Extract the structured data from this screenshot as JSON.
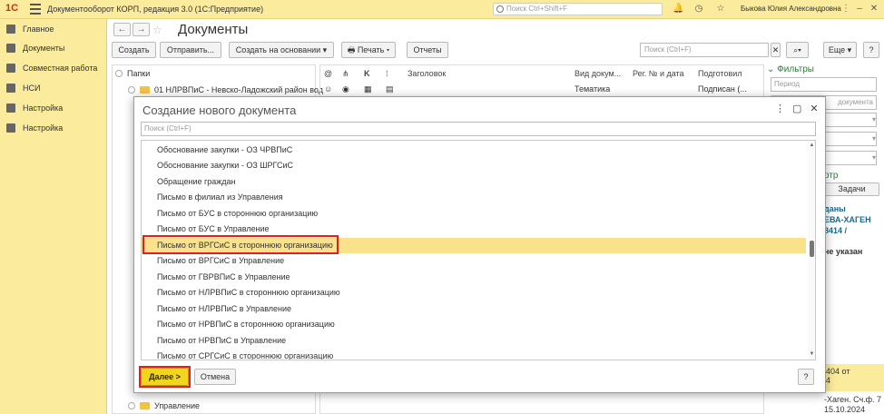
{
  "titlebar": {
    "app_title": "Документооборот КОРП, редакция 3.0  (1С:Предприятие)",
    "search_placeholder": "Поиск Ctrl+Shift+F",
    "user": "Быкова Юлия Александровна",
    "logo": "1С"
  },
  "sidebar": {
    "items": [
      {
        "label": "Главное",
        "icon": "menu-icon"
      },
      {
        "label": "Документы",
        "icon": "documents-icon"
      },
      {
        "label": "Совместная работа",
        "icon": "people-icon"
      },
      {
        "label": "НСИ",
        "icon": "book-icon"
      },
      {
        "label": "Настройка",
        "icon": "gear-icon"
      },
      {
        "label": "Настройка",
        "icon": "gear-icon"
      }
    ]
  },
  "main": {
    "title": "Документы",
    "toolbar": {
      "create": "Создать",
      "send": "Отправить...",
      "create_based": "Создать на основании",
      "print": "Печать",
      "reports": "Отчеты",
      "search_placeholder": "Поиск (Ctrl+F)",
      "more": "Еще"
    },
    "folders": {
      "header": "Папки",
      "rows": [
        "01 НЛРВПиС - Невско-Ладожский район вод",
        "Управление"
      ]
    },
    "grid": {
      "columns": [
        "Заголовок",
        "Вид докум...",
        "Рег. № и дата",
        "Подготовил"
      ],
      "row1": {
        "type": "Тематика",
        "prepared": "Подписан (..."
      }
    },
    "filters": {
      "title": "Фильтры",
      "period_placeholder": "Период",
      "doc_placeholder": "документа",
      "tasks_tab": "Задачи",
      "partial_lines": [
        "отр",
        "даны",
        "ЕВА-ХАГЕН",
        "8414 /",
        "не указан",
        "404 от",
        "4",
        "-Хаген. Сч.ф. 7",
        "15.10.2024"
      ]
    }
  },
  "dialog": {
    "title": "Создание нового документа",
    "search_placeholder": "Поиск (Ctrl+F)",
    "items": [
      "Обоснование закупки - ОЗ ЧРВПиС",
      "Обоснование закупки - ОЗ ШРГСиС",
      "Обращение граждан",
      "Письмо в филиал из Управления",
      "Письмо от БУС в стороннюю организацию",
      "Письмо от БУС в Управление",
      "Письмо от ВРГСиС в стороннюю организацию",
      "Письмо от ВРГСиС в Управление",
      "Письмо от ГВРВПиС в Управление",
      "Письмо от НЛРВПиС в стороннюю организацию",
      "Письмо от НЛРВПиС в Управление",
      "Письмо от НРВПиС в стороннюю организацию",
      "Письмо от НРВПиС в Управление",
      "Письмо от СРГСиС в стороннюю организацию"
    ],
    "selected_index": 6,
    "next": "Далее >",
    "cancel": "Отмена",
    "help": "?"
  }
}
